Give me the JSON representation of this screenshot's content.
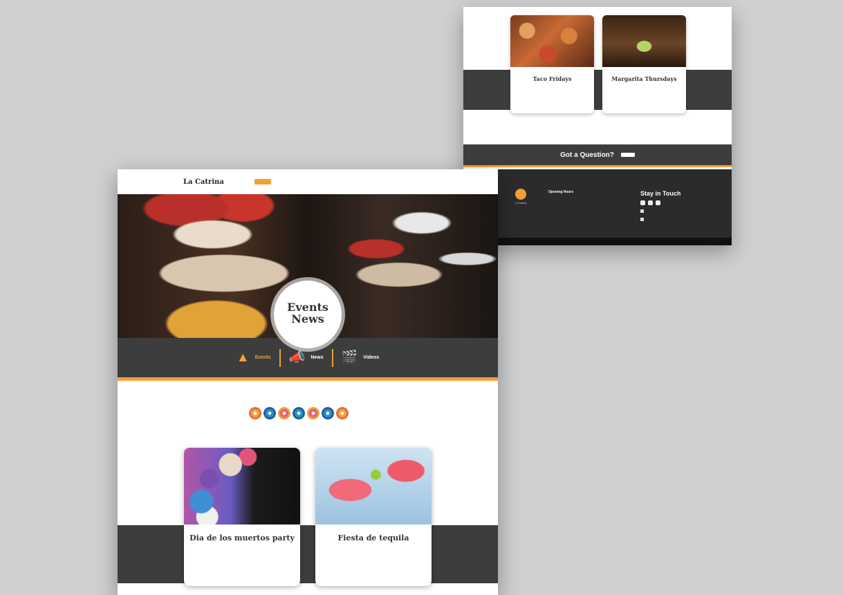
{
  "back": {
    "cards": [
      {
        "title": "Taco Fridays",
        "text": ""
      },
      {
        "title": "Margarita Thursdays",
        "text": ""
      }
    ],
    "question": {
      "text": "Got a Question?",
      "button": ""
    },
    "footer": {
      "opening_title": "Opening Hours",
      "links_title": "",
      "stay_title": "Stay in Touch"
    }
  },
  "front": {
    "brand": {
      "name": "La Catrina",
      "tagline": ""
    },
    "nav": [],
    "nav_button": "",
    "badge": {
      "small": "",
      "line1": "Events",
      "line2": "News"
    },
    "tabs": [
      {
        "label": "Events",
        "icon": "sombrero-icon"
      },
      {
        "label": "News",
        "icon": "megaphone-icon"
      },
      {
        "label": "Videos",
        "icon": "clapperboard-icon"
      }
    ],
    "cards": [
      {
        "title": "Dia de los muertos party",
        "text": ""
      },
      {
        "title": "Fiesta de tequila",
        "text": ""
      }
    ]
  },
  "colors": {
    "accent": "#f0a236",
    "dark": "#3d3d3d",
    "background": "#cfd0d2"
  }
}
